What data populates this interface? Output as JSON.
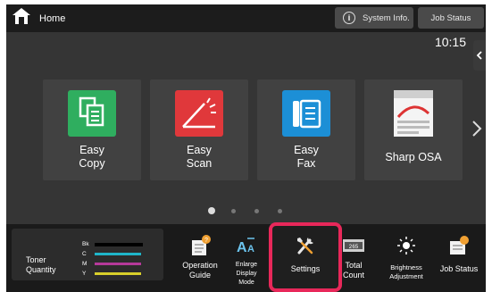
{
  "topbar": {
    "home_label": "Home",
    "system_info_label": "System Info.",
    "job_status_label": "Job Status",
    "clock": "10:15"
  },
  "tiles": [
    {
      "label_line1": "Easy",
      "label_line2": "Copy"
    },
    {
      "label_line1": "Easy",
      "label_line2": "Scan"
    },
    {
      "label_line1": "Easy",
      "label_line2": "Fax"
    },
    {
      "label_line1": "Sharp OSA",
      "label_line2": ""
    }
  ],
  "pagination": {
    "page_count": 4,
    "active_page": 1
  },
  "toner": {
    "label_line1": "Toner",
    "label_line2": "Quantity",
    "rows": [
      {
        "key": "Bk",
        "color": "#111111"
      },
      {
        "key": "C",
        "color": "#1fb5c9"
      },
      {
        "key": "M",
        "color": "#b5399a"
      },
      {
        "key": "Y",
        "color": "#d8cf2b"
      }
    ]
  },
  "functions": {
    "operation_guide": {
      "line1": "Operation",
      "line2": "Guide"
    },
    "enlarge_display": {
      "line1": "Enlarge",
      "line2": "Display",
      "line3": "Mode"
    },
    "settings": {
      "line1": "Settings"
    },
    "total_count": {
      "line1": "Total",
      "line2": "Count"
    },
    "brightness": {
      "line1": "Brightness",
      "line2": "Adjustment"
    },
    "job_status": {
      "line1": "Job Status"
    }
  },
  "colors": {
    "copy_tile": "#2fae5f",
    "scan_tile": "#e0383b",
    "fax_tile": "#1c8fd6",
    "highlight": "#e8285a",
    "badge": "#f0a033"
  }
}
